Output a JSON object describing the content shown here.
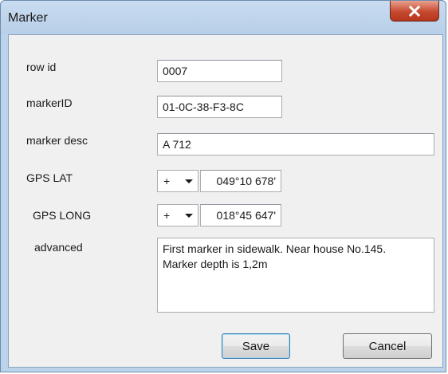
{
  "window": {
    "title": "Marker"
  },
  "form": {
    "row_id": {
      "label": "row id",
      "value": "0007"
    },
    "marker_id": {
      "label": "markerID",
      "value": "01-0C-38-F3-8C"
    },
    "marker_desc": {
      "label": "marker desc",
      "value": "A 712"
    },
    "gps_lat": {
      "label": "GPS LAT",
      "sign": "+",
      "value": "049°10 678'"
    },
    "gps_long": {
      "label": "GPS LONG",
      "sign": "+",
      "value": "018°45 647'"
    },
    "advanced": {
      "label": "advanced",
      "line1": "First marker in sidewalk. Near house No.145.",
      "line2": "Marker depth is 1,2m"
    }
  },
  "buttons": {
    "save": "Save",
    "cancel": "Cancel"
  },
  "colors": {
    "close_button": "#c5492f",
    "title_bar": "#bcd3ec"
  }
}
